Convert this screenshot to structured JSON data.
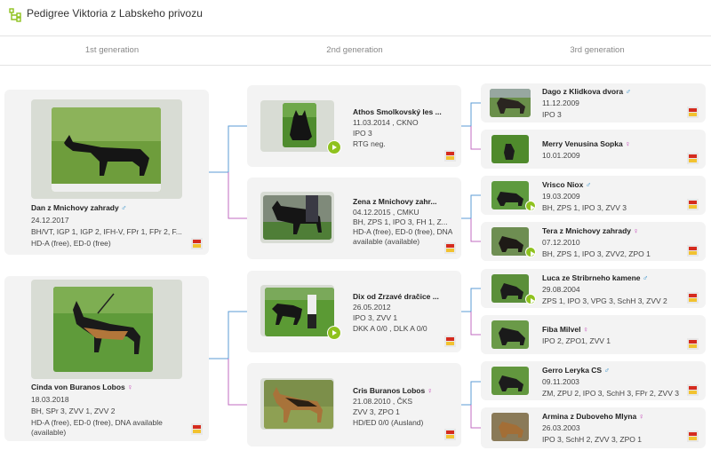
{
  "page": {
    "title": "Pedigree Viktoria z Labskeho privozu"
  },
  "generations": [
    "1st generation",
    "2nd generation",
    "3rd generation"
  ],
  "colors": {
    "male": "#2a8ac8",
    "female": "#c23bb4",
    "accent": "#8fc21f"
  },
  "gen1": [
    {
      "name": "Dan z Mnichovy zahrady",
      "sex": "♂",
      "date": "24.12.2017",
      "line1": "BH/VT, IGP 1, IGP 2, IFH-V, FPr 1, FPr 2, F...",
      "line2": "HD-A (free), ED-0 (free)"
    },
    {
      "name": "Cinda von Buranos Lobos",
      "sex": "♀",
      "date": "18.03.2018",
      "line1": "BH, SPr 3, ZVV 1, ZVV 2",
      "line2": "HD-A (free), ED-0 (free), DNA available (available)"
    }
  ],
  "gen2": [
    {
      "name": "Athos Smolkovský les ...",
      "sex": "",
      "date": "11.03.2014 , CKNO",
      "line1": "IPO 3",
      "line2": "RTG neg.",
      "video": true
    },
    {
      "name": "Zena z Mnichovy zahr...",
      "sex": "",
      "date": "04.12.2015 , CMKU",
      "line1": "BH, ZPS 1, IPO 3, FH 1, Z...",
      "line2": "HD-A (free), ED-0 (free), DNA available (available)",
      "video": false
    },
    {
      "name": "Dix od Zrzavé dračice ...",
      "sex": "",
      "date": "26.05.2012",
      "line1": "IPO 3, ZVV 1",
      "line2": "DKK A 0/0 , DLK A 0/0",
      "video": true
    },
    {
      "name": "Cris Buranos Lobos",
      "sex": "♀",
      "date": "21.08.2010 , ČKS",
      "line1": "ZVV 3, ZPO 1",
      "line2": "HD/ED 0/0 (Ausland)",
      "video": false
    }
  ],
  "gen3": [
    {
      "name": "Dago z Klidkova dvora",
      "sex": "♂",
      "date": "11.12.2009",
      "line1": "IPO 3",
      "video": false
    },
    {
      "name": "Merry Venusina Sopka",
      "sex": "♀",
      "date": "10.01.2009",
      "line1": "",
      "video": false
    },
    {
      "name": "Vrisco Niox",
      "sex": "♂",
      "date": "19.03.2009",
      "line1": "BH, ZPS 1, IPO 3, ZVV 3",
      "video": true
    },
    {
      "name": "Tera z Mnichovy zahrady",
      "sex": "♀",
      "date": "07.12.2010",
      "line1": "BH, ZPS 1, IPO 3, ZVV2, ZPO 1",
      "video": true
    },
    {
      "name": "Luca ze Stribrneho kamene",
      "sex": "♂",
      "date": "29.08.2004",
      "line1": "ZPS 1, IPO 3, VPG 3, SchH 3, ZVV 2",
      "video": true
    },
    {
      "name": "Fiba Milvel",
      "sex": "♀",
      "date": "",
      "line1": "IPO 2, ZPO1, ZVV 1",
      "video": false
    },
    {
      "name": "Gerro Leryka CS",
      "sex": "♂",
      "date": "09.11.2003",
      "line1": "ZM, ZPU 2, IPO 3, SchH 3, FPr 2, ZVV 3",
      "video": false
    },
    {
      "name": "Armina z Duboveho Mlyna",
      "sex": "♀",
      "date": "26.03.2003",
      "line1": "IPO 3, SchH 2, ZVV 3, ZPO 1",
      "video": false
    }
  ]
}
